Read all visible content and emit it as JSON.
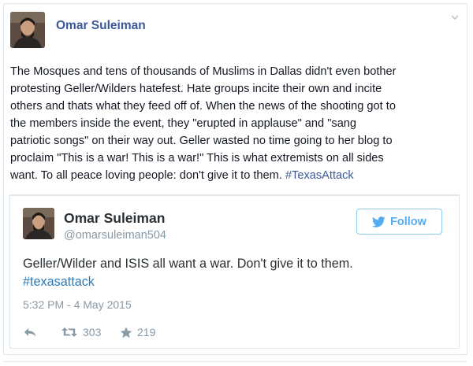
{
  "post": {
    "author": "Omar Suleiman",
    "text": "The Mosques and tens of thousands of Muslims in Dallas didn't even bother\nprotesting Geller/Wilders hatefest. Hate groups incite their own and incite\nothers and thats what they feed off of. When the news of the shooting got to\nthe members inside the event, they \"erupted in applause\" and \"sang\npatriotic songs\" on their way out. Geller wasted no time going to her blog to\nproclaim \"This is a war! This is a war!\" This is what extremists on all sides\nwant. To all peace loving people: don't give it to them. ",
    "hashtag": "#TexasAttack",
    "menu_icon": "chevron-down-icon"
  },
  "tweet": {
    "name": "Omar Suleiman",
    "handle": "@omarsuleiman504",
    "follow_label": "Follow",
    "follow_icon": "twitter-bird-icon",
    "text": "Geller/Wilder and ISIS all want a war. Don't give it to them.",
    "hashtag": "#texasattack",
    "timestamp": "5:32 PM - 4 May 2015",
    "retweets": "303",
    "favorites": "219",
    "accent_color": "#55acee"
  },
  "colors": {
    "facebook_link": "#3b5998",
    "text": "#141823",
    "muted": "#8899a6",
    "border": "#e1e8ed"
  }
}
